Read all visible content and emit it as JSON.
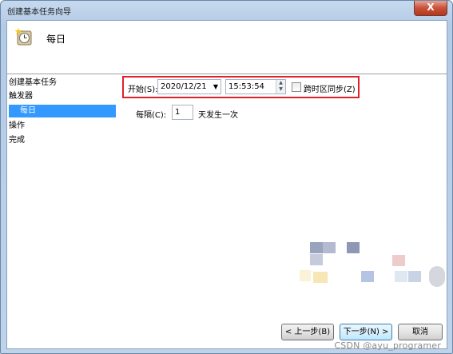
{
  "window": {
    "title": "创建基本任务向导",
    "close_glyph": "X"
  },
  "header": {
    "title": "每日",
    "icon": "clock-icon"
  },
  "steps": [
    {
      "label": "创建基本任务",
      "selected": false
    },
    {
      "label": "触发器",
      "selected": false
    },
    {
      "label": "每日",
      "selected": true
    },
    {
      "label": "操作",
      "selected": false
    },
    {
      "label": "完成",
      "selected": false
    }
  ],
  "form": {
    "start_label": "开始(S):",
    "start_date": "2020/12/21",
    "start_time": "15:53:54",
    "sync_timezone_label": "跨时区同步(Z)",
    "sync_timezone_checked": false,
    "recur_label": "每隔(C):",
    "recur_value": "1",
    "recur_suffix": "天发生一次"
  },
  "footer": {
    "back_label": "< 上一步(B)",
    "next_label": "下一步(N) >",
    "cancel_label": "取消"
  },
  "watermark": "CSDN @ayu_programer",
  "colors": {
    "selection": "#3399ff",
    "highlight_border": "#e0202a"
  }
}
